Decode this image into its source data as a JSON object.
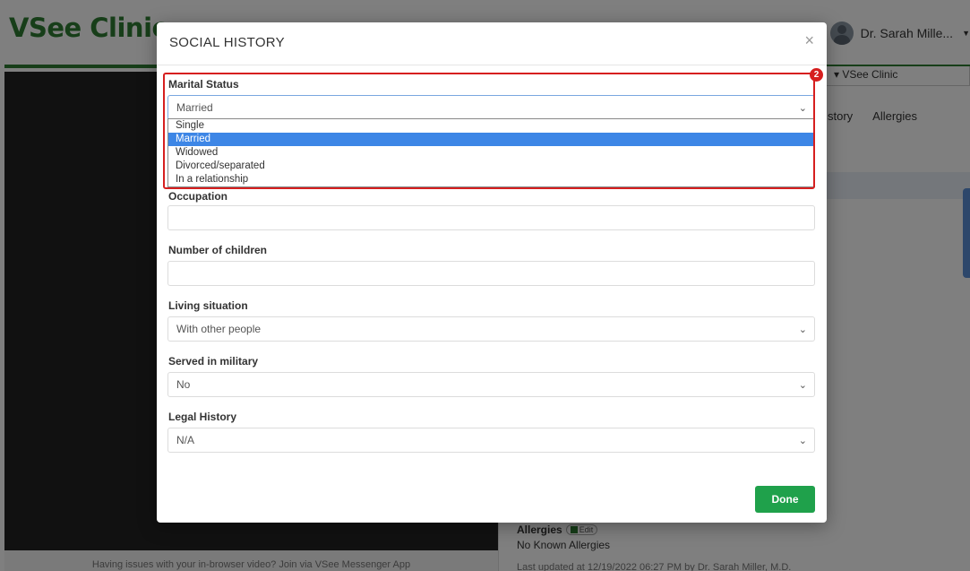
{
  "app": {
    "brand": "VSee Clinic",
    "user_name": "Dr. Sarah Mille...",
    "clinic_selector": "VSee Clinic",
    "tabs": [
      "story",
      "Allergies"
    ],
    "video_footer": "Having issues with your in-browser video? Join via VSee Messenger App",
    "allergies": {
      "heading": "Allergies",
      "edit_label": "Edit",
      "value": "No Known Allergies",
      "last_updated": "Last updated at 12/19/2022 06:27 PM by Dr. Sarah Miller, M.D."
    }
  },
  "modal": {
    "title": "SOCIAL HISTORY",
    "close_glyph": "×",
    "step_badge": "2",
    "marital_status": {
      "label": "Marital Status",
      "value": "Married",
      "options": [
        "Single",
        "Married",
        "Widowed",
        "Divorced/separated",
        "In a relationship"
      ],
      "selected_option": "Married"
    },
    "occupation": {
      "label": "Occupation",
      "value": ""
    },
    "children": {
      "label": "Number of children",
      "value": ""
    },
    "living": {
      "label": "Living situation",
      "value": "With other people"
    },
    "military": {
      "label": "Served in military",
      "value": "No"
    },
    "legal": {
      "label": "Legal History",
      "value": "N/A"
    },
    "done_label": "Done"
  },
  "colors": {
    "brand_green": "#2e7d32",
    "done_green": "#1fa14b",
    "highlight_red": "#d61f1f",
    "selected_blue": "#3d86e6"
  },
  "icons": [
    "close-icon",
    "chevron-down-icon",
    "avatar-icon",
    "edit-icon"
  ]
}
